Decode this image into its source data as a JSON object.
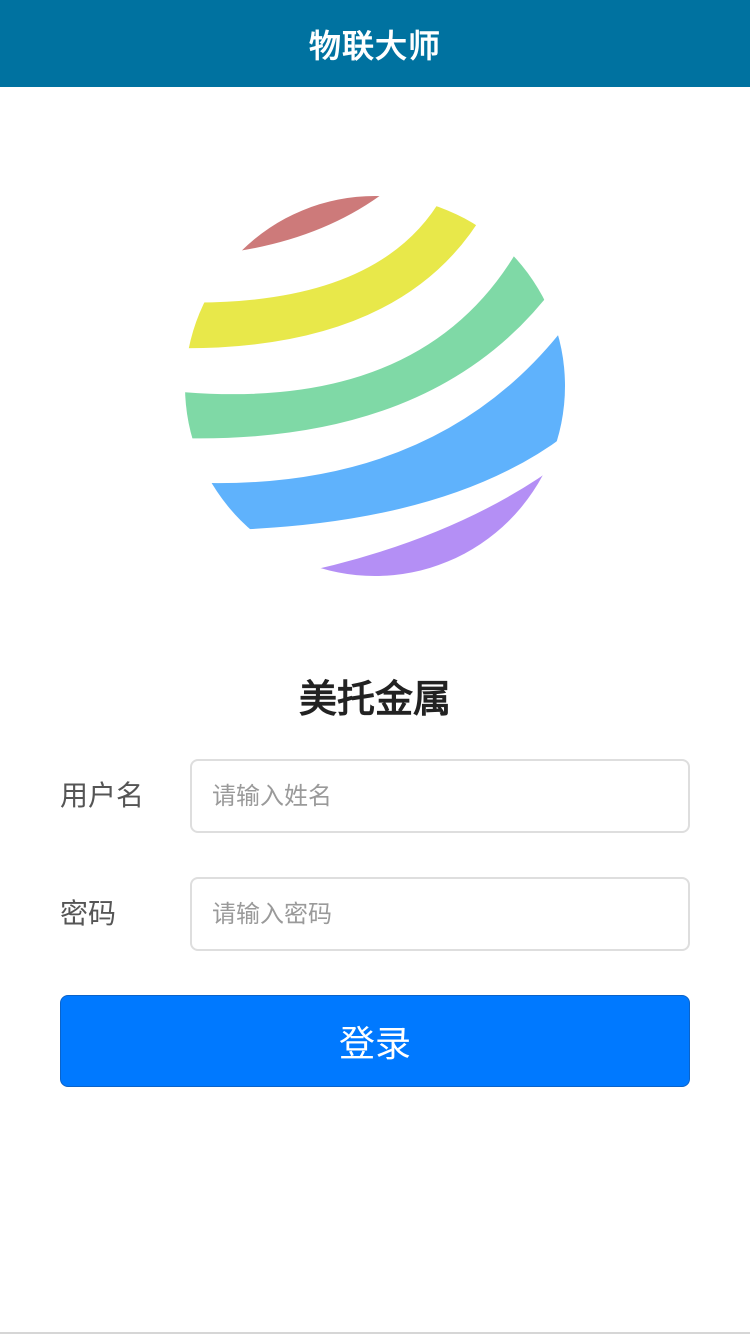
{
  "header": {
    "title": "物联大师",
    "background_color": "#0072a0"
  },
  "logo": {
    "icon": "striped-globe-logo",
    "colors": [
      "#cd7a7a",
      "#e8e84a",
      "#7fd9a6",
      "#5fb2fc",
      "#b48ff5"
    ]
  },
  "company": {
    "name": "美托金属"
  },
  "form": {
    "username": {
      "label": "用户名",
      "placeholder": "请输入姓名",
      "value": ""
    },
    "password": {
      "label": "密码",
      "placeholder": "请输入密码",
      "value": ""
    },
    "login_label": "登录",
    "login_color": "#0079ff"
  }
}
